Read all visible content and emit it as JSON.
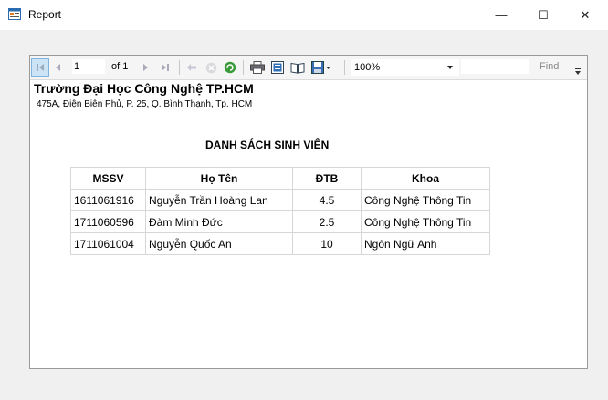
{
  "window": {
    "title": "Report",
    "icon": "report-window-icon",
    "controls": {
      "minimize": "—",
      "maximize": "☐",
      "close": "✕"
    }
  },
  "toolbar": {
    "page_current": "1",
    "page_of": "of 1",
    "zoom": "100%",
    "find_label": "Find",
    "icons": [
      "first-page-icon",
      "prev-page-icon",
      "next-page-icon",
      "last-page-icon",
      "back-icon",
      "stop-icon",
      "refresh-icon",
      "print-icon",
      "print-layout-icon",
      "page-setup-icon",
      "export-icon"
    ]
  },
  "report": {
    "org_name": "Trường Đại Học Công Nghệ TP.HCM",
    "address": "475A, Điện Biên Phủ, P. 25, Q. Bình Thạnh, Tp. HCM",
    "heading": "DANH SÁCH SINH VIÊN",
    "columns": [
      "MSSV",
      "Họ Tên",
      "ĐTB",
      "Khoa"
    ],
    "rows": [
      [
        "1611061916",
        "Nguyễn Trần Hoàng Lan",
        "4.5",
        "Công Nghệ Thông Tin"
      ],
      [
        "1711060596",
        "Đàm Minh Đức",
        "2.5",
        "Công Nghệ Thông Tin"
      ],
      [
        "1711061004",
        "Nguyễn Quốc An",
        "10",
        "Ngôn Ngữ Anh"
      ]
    ]
  }
}
